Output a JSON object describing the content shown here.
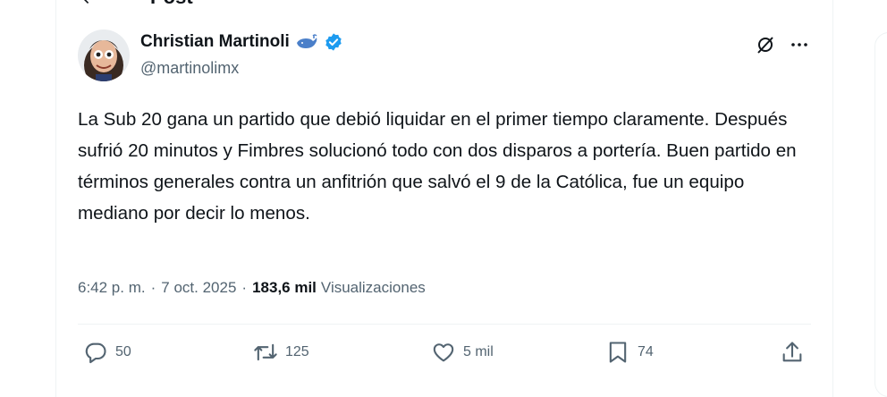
{
  "header": {
    "title": "Post"
  },
  "author": {
    "name": "Christian Martinoli",
    "handle": "@martinolimx"
  },
  "tweet": {
    "text": "La Sub 20 gana un partido que debió liquidar en el primer tiempo claramente. Después sufrió 20 minutos y Fimbres solucionó todo con dos disparos a portería. Buen partido en términos generales contra un anfitrión que salvó el 9 de la Católica, fue un equipo mediano por decir lo menos."
  },
  "meta": {
    "time": "6:42 p. m.",
    "separator1": "·",
    "date": "7 oct. 2025",
    "separator2": "·",
    "views_count": "183,6 mil",
    "views_label": "Visualizaciones"
  },
  "actions": {
    "replies": "50",
    "reposts": "125",
    "likes": "5 mil",
    "bookmarks": "74"
  },
  "colors": {
    "text": "#0f1419",
    "secondary": "#536471",
    "verified": "#1d9bf0",
    "divider": "#eff3f4"
  },
  "icons": [
    "back-arrow-icon",
    "whale-icon",
    "verified-badge-icon",
    "grok-icon",
    "more-icon",
    "reply-icon",
    "repost-icon",
    "like-icon",
    "bookmark-icon",
    "share-icon"
  ]
}
